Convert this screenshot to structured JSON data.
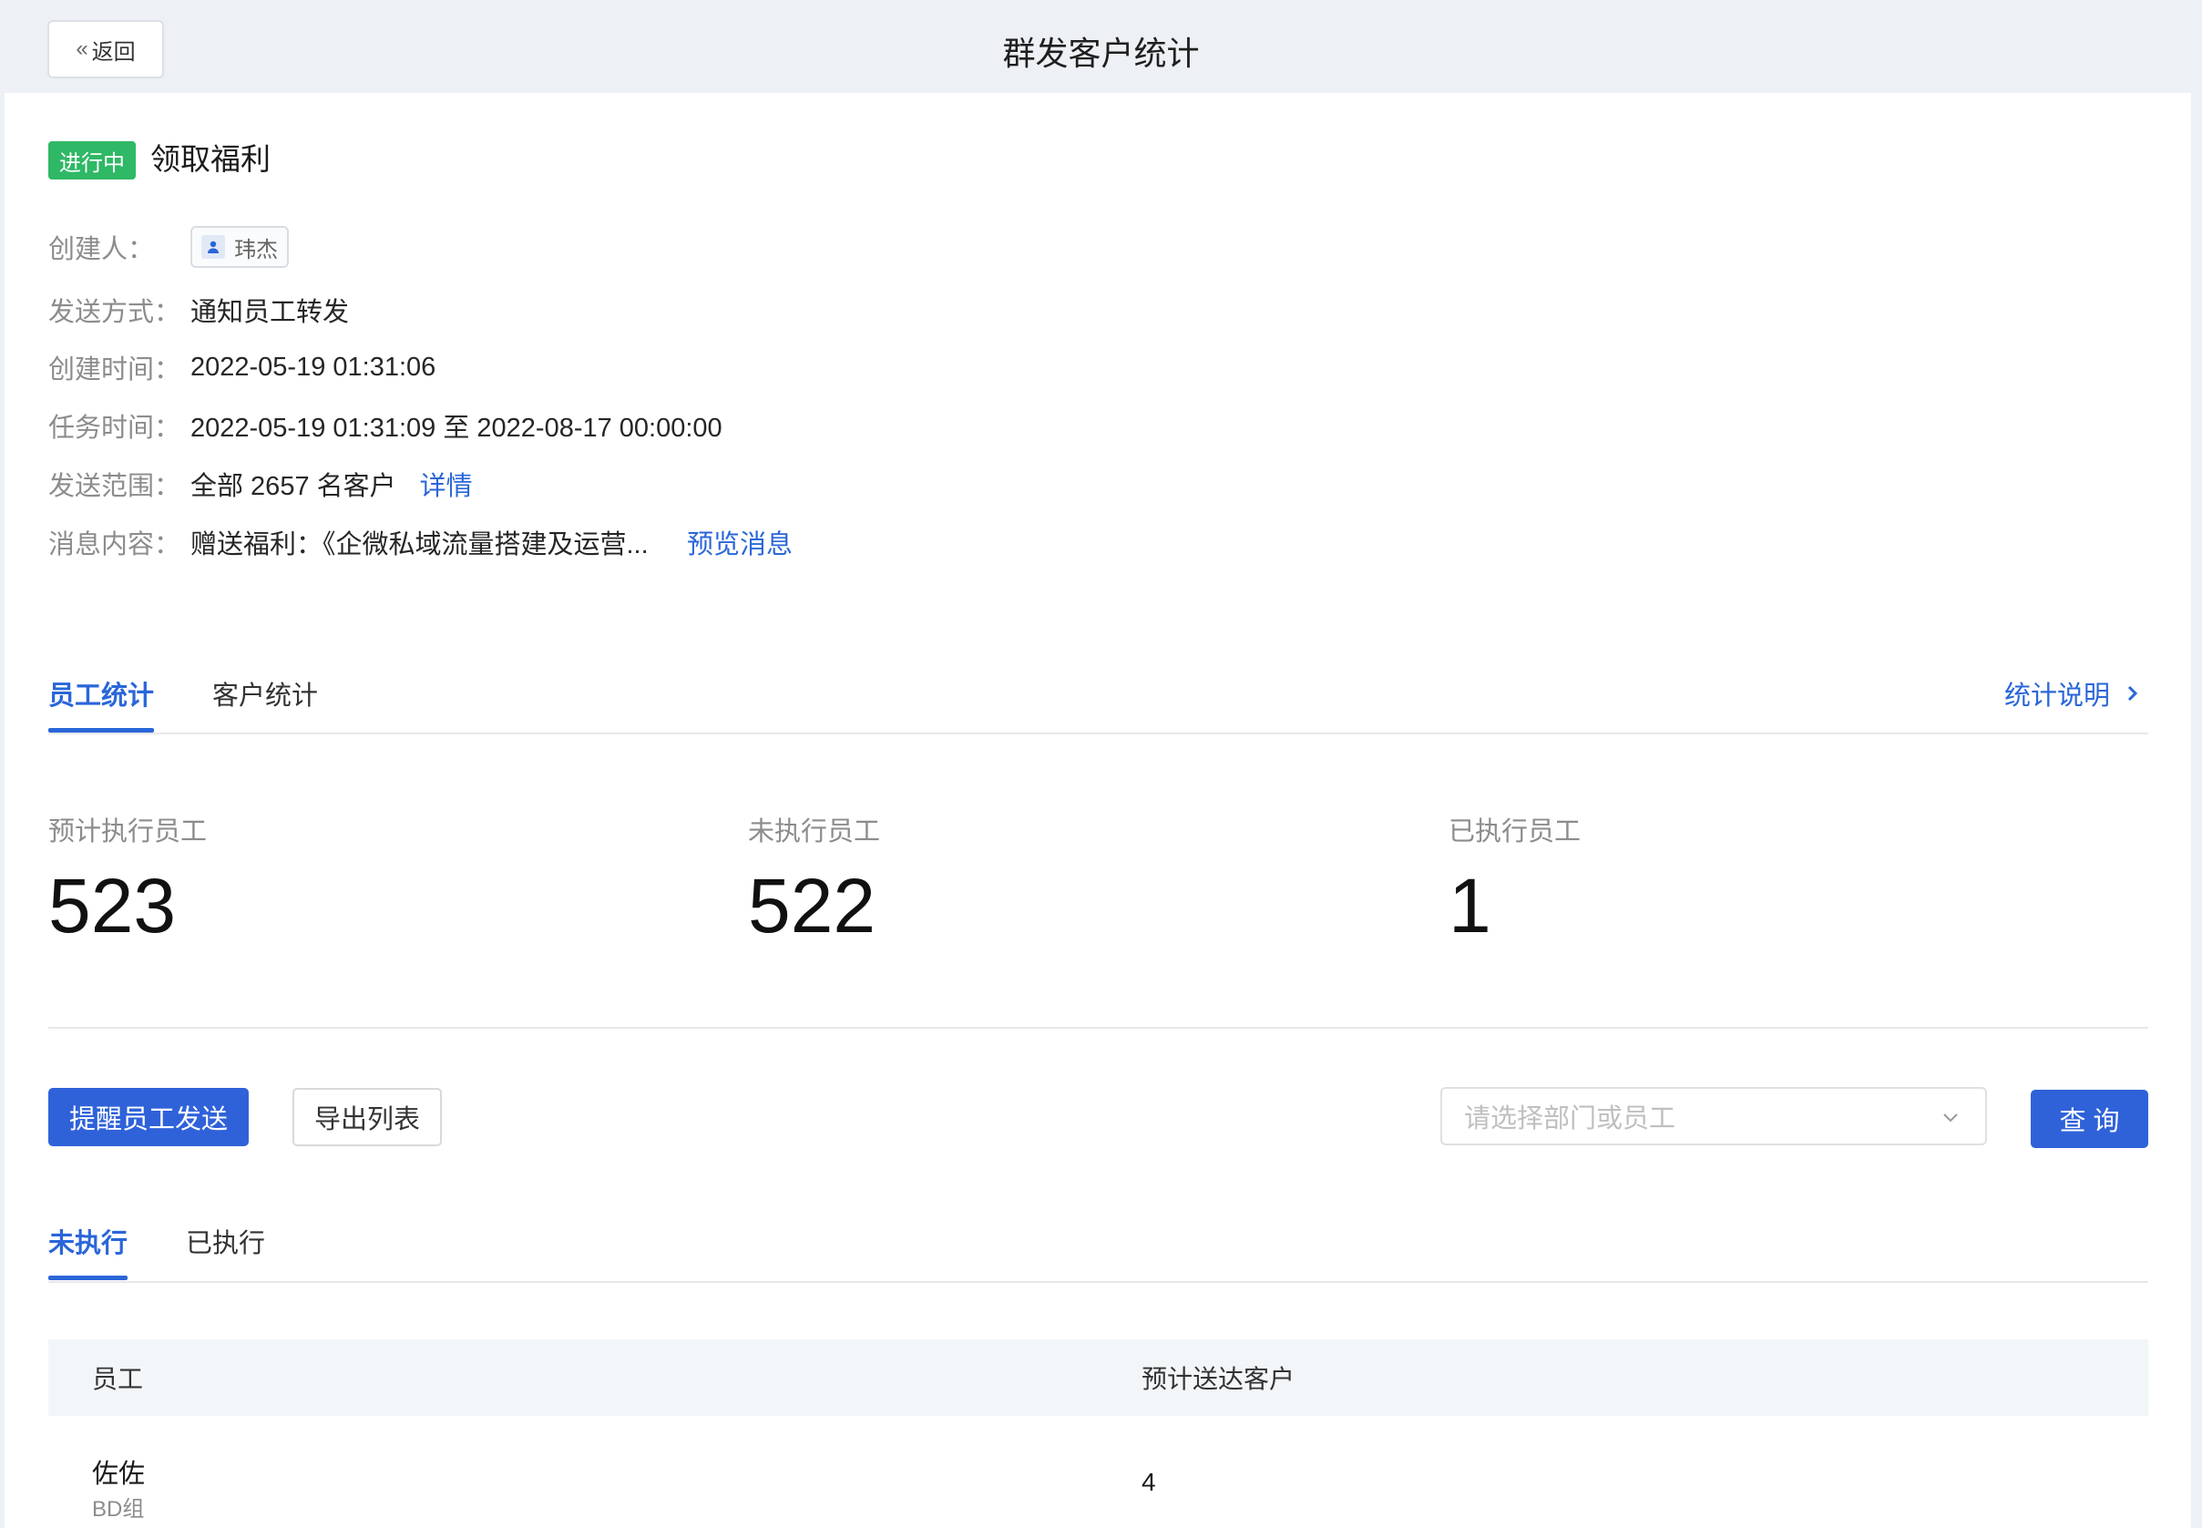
{
  "header": {
    "back_label": "返回",
    "title": "群发客户统计"
  },
  "task": {
    "status": "进行中",
    "name": "领取福利",
    "status_color": "#2fb865"
  },
  "info": {
    "creator_label": "创建人：",
    "creator_name": "玮杰",
    "send_method_label": "发送方式：",
    "send_method": "通知员工转发",
    "created_label": "创建时间：",
    "created_time": "2022-05-19 01:31:06",
    "task_time_label": "任务时间：",
    "task_time": "2022-05-19 01:31:09 至 2022-08-17 00:00:00",
    "scope_label": "发送范围：",
    "scope": "全部 2657 名客户",
    "scope_link": "详情",
    "content_label": "消息内容：",
    "content": "赠送福利：《企微私域流量搭建及运营...",
    "content_link": "预览消息"
  },
  "main_tabs": [
    {
      "label": "员工统计",
      "active": true
    },
    {
      "label": "客户统计",
      "active": false
    }
  ],
  "stats_note": "统计说明",
  "stats": [
    {
      "label": "预计执行员工",
      "value": "523"
    },
    {
      "label": "未执行员工",
      "value": "522"
    },
    {
      "label": "已执行员工",
      "value": "1"
    }
  ],
  "actions": {
    "remind_label": "提醒员工发送",
    "export_label": "导出列表",
    "select_placeholder": "请选择部门或员工",
    "query_label": "查 询"
  },
  "sub_tabs": [
    {
      "label": "未执行",
      "active": true
    },
    {
      "label": "已执行",
      "active": false
    }
  ],
  "table": {
    "columns": [
      "员工",
      "预计送达客户"
    ],
    "rows": [
      {
        "name": "佐佐",
        "dept": "BD组",
        "count": "4"
      }
    ]
  },
  "accent_color": "#2a66d9"
}
